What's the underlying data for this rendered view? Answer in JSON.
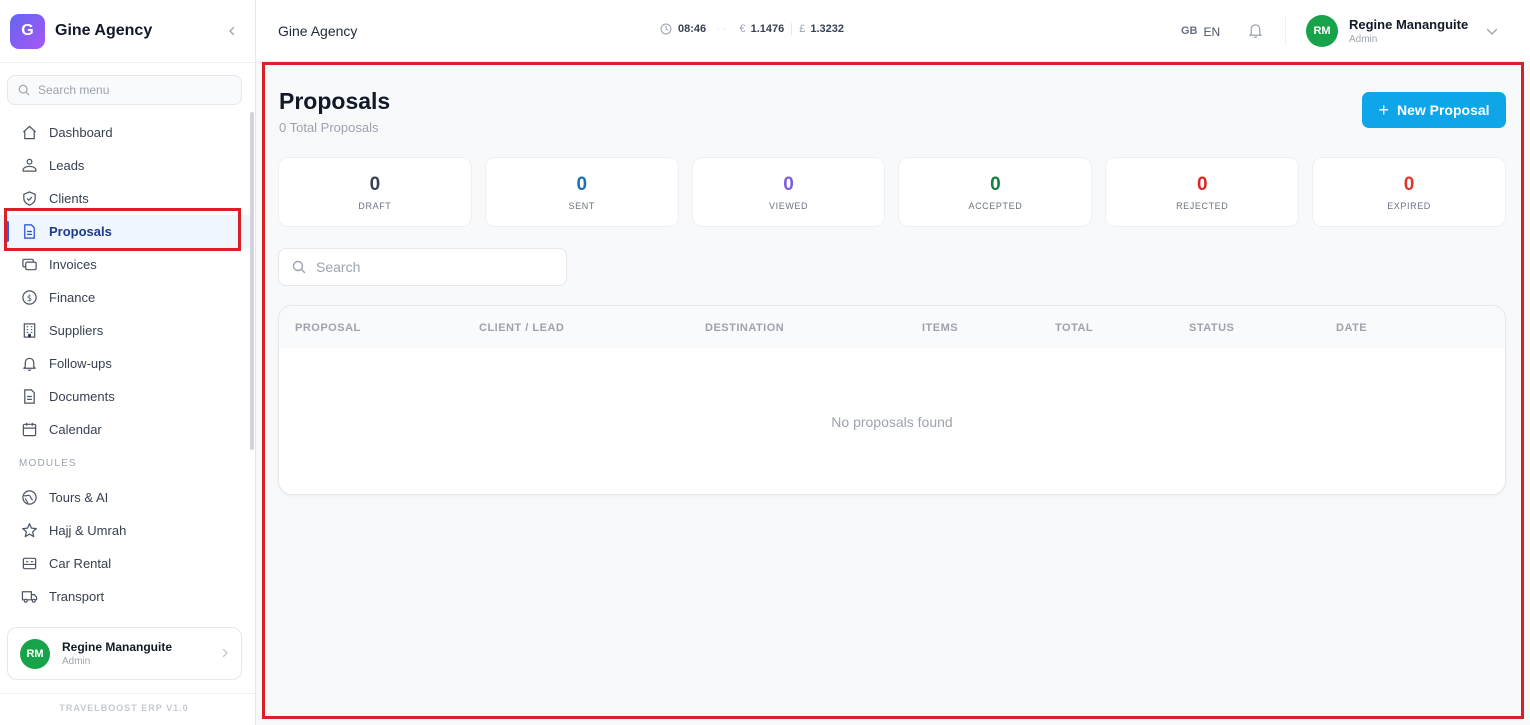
{
  "brand": {
    "logo_letter": "G",
    "name": "Gine Agency"
  },
  "sidebar": {
    "search_placeholder": "Search menu",
    "items": [
      {
        "label": "Dashboard",
        "icon": "home-icon"
      },
      {
        "label": "Leads",
        "icon": "users-icon"
      },
      {
        "label": "Clients",
        "icon": "shield-icon"
      },
      {
        "label": "Proposals",
        "icon": "document-icon",
        "active": true
      },
      {
        "label": "Invoices",
        "icon": "cards-icon"
      },
      {
        "label": "Finance",
        "icon": "dollar-icon"
      },
      {
        "label": "Suppliers",
        "icon": "building-icon"
      },
      {
        "label": "Follow-ups",
        "icon": "bell-icon"
      },
      {
        "label": "Documents",
        "icon": "file-icon"
      },
      {
        "label": "Calendar",
        "icon": "calendar-icon"
      }
    ],
    "modules_label": "MODULES",
    "modules": [
      {
        "label": "Tours & AI",
        "icon": "globe-icon"
      },
      {
        "label": "Hajj & Umrah",
        "icon": "star-icon"
      },
      {
        "label": "Car Rental",
        "icon": "car-icon"
      },
      {
        "label": "Transport",
        "icon": "truck-icon"
      }
    ],
    "user": {
      "initials": "RM",
      "name": "Regine Mananguite",
      "role": "Admin"
    },
    "version": "TRAVELBOOST ERP V1.0"
  },
  "topbar": {
    "title": "Gine Agency",
    "time": "08:46",
    "eur_symbol": "€",
    "eur_rate": "1.1476",
    "gbp_symbol": "£",
    "gbp_rate": "1.3232",
    "lang_flag": "GB",
    "lang_code": "EN",
    "user": {
      "initials": "RM",
      "name": "Regine Mananguite",
      "role": "Admin"
    }
  },
  "main": {
    "title": "Proposals",
    "subtitle": "0 Total Proposals",
    "new_button": "New Proposal",
    "stats": [
      {
        "value": "0",
        "label": "DRAFT",
        "color": "#374151"
      },
      {
        "value": "0",
        "label": "SENT",
        "color": "#1d6fb8"
      },
      {
        "value": "0",
        "label": "VIEWED",
        "color": "#7c5ce0"
      },
      {
        "value": "0",
        "label": "ACCEPTED",
        "color": "#15803d"
      },
      {
        "value": "0",
        "label": "REJECTED",
        "color": "#dc2626"
      },
      {
        "value": "0",
        "label": "EXPIRED",
        "color": "#e0352b"
      }
    ],
    "search_placeholder": "Search",
    "table": {
      "columns": [
        "PROPOSAL",
        "CLIENT / LEAD",
        "DESTINATION",
        "ITEMS",
        "TOTAL",
        "STATUS",
        "DATE"
      ],
      "empty_text": "No proposals found"
    }
  },
  "colors": {
    "accent": "#0ea5e9",
    "highlight": "#d92027",
    "avatar": "#16a34a"
  }
}
